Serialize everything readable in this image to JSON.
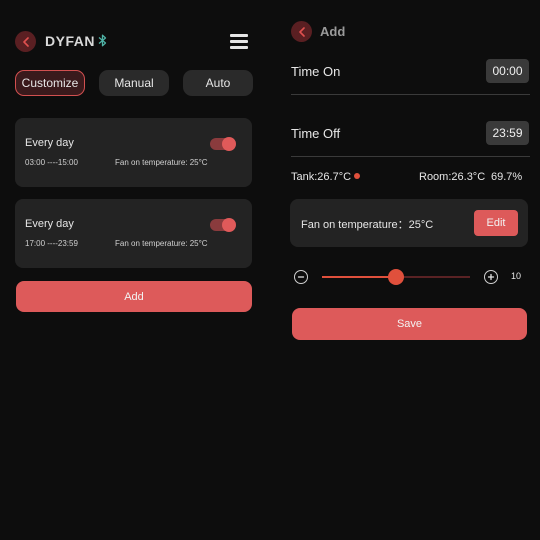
{
  "colors": {
    "background": "#0d0d0d",
    "card": "#232323",
    "accent": "#dd5a5a",
    "accent_dark": "#5a1f22",
    "bluetooth": "#4fb3a6"
  },
  "left_screen": {
    "back_icon": "chevron-left-icon",
    "brand": "DYFAN",
    "bluetooth_icon": "bluetooth-icon",
    "menu_icon": "hamburger-menu-icon",
    "tabs": [
      {
        "label": "Customize",
        "active": true
      },
      {
        "label": "Manual",
        "active": false
      },
      {
        "label": "Auto",
        "active": false
      }
    ],
    "schedules": [
      {
        "title": "Every day",
        "range": "03:00 ----15:00",
        "fan_temp": "Fan on temperature: 25°C",
        "enabled": true
      },
      {
        "title": "Every day",
        "range": "17:00 ----23:59",
        "fan_temp": "Fan on temperature: 25°C",
        "enabled": true
      }
    ],
    "add_label": "Add"
  },
  "right_screen": {
    "back_icon": "chevron-left-icon",
    "title": "Add",
    "time_on_label": "Time On",
    "time_on_value": "00:00",
    "time_off_label": "Time Off",
    "time_off_value": "23:59",
    "tank": "Tank:26.7°C",
    "room": "Room:26.3°C",
    "humidity": "69.7%",
    "fan_temp_label": "Fan on temperature：25°C",
    "edit_label": "Edit",
    "slider": {
      "minus_icon": "minus-icon",
      "plus_icon": "plus-icon",
      "value": "10",
      "level_fraction": 0.5
    },
    "save_label": "Save"
  }
}
